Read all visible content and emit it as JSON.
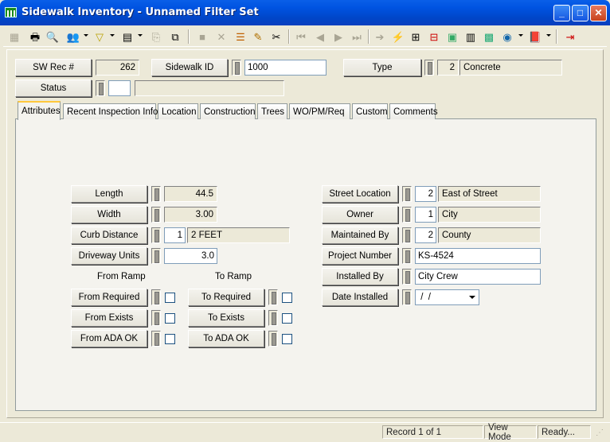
{
  "window": {
    "title": "Sidewalk Inventory - Unnamed Filter Set"
  },
  "header": {
    "sw_rec_label": "SW Rec #",
    "sw_rec_value": "262",
    "sidewalk_id_label": "Sidewalk ID",
    "sidewalk_id_value": "1000",
    "type_label": "Type",
    "type_code": "2",
    "type_desc": "Concrete",
    "status_label": "Status",
    "status_code": "",
    "status_desc": ""
  },
  "tabs": [
    "Attributes",
    "Recent Inspection Info",
    "Location",
    "Construction",
    "Trees",
    "WO/PM/Req",
    "Custom",
    "Comments"
  ],
  "left": {
    "length_label": "Length",
    "length_value": "44.5",
    "width_label": "Width",
    "width_value": "3.00",
    "curb_label": "Curb Distance",
    "curb_code": "1",
    "curb_desc": "2 FEET",
    "driveway_label": "Driveway Units",
    "driveway_value": "3.0",
    "from_ramp_heading": "From Ramp",
    "to_ramp_heading": "To Ramp",
    "from_required": "From Required",
    "from_exists": "From Exists",
    "from_ada": "From ADA OK",
    "to_required": "To Required",
    "to_exists": "To  Exists",
    "to_ada": "To ADA OK"
  },
  "right": {
    "street_loc_label": "Street Location",
    "street_loc_code": "2",
    "street_loc_desc": "East of Street",
    "owner_label": "Owner",
    "owner_code": "1",
    "owner_desc": "City",
    "maint_label": "Maintained By",
    "maint_code": "2",
    "maint_desc": "County",
    "project_label": "Project Number",
    "project_value": "KS-4524",
    "installed_by_label": "Installed By",
    "installed_by_value": "City Crew",
    "date_installed_label": "Date Installed",
    "date_installed_value": " /  /"
  },
  "status": {
    "record": "Record 1 of 1",
    "mode": "View Mode",
    "state": "Ready..."
  }
}
